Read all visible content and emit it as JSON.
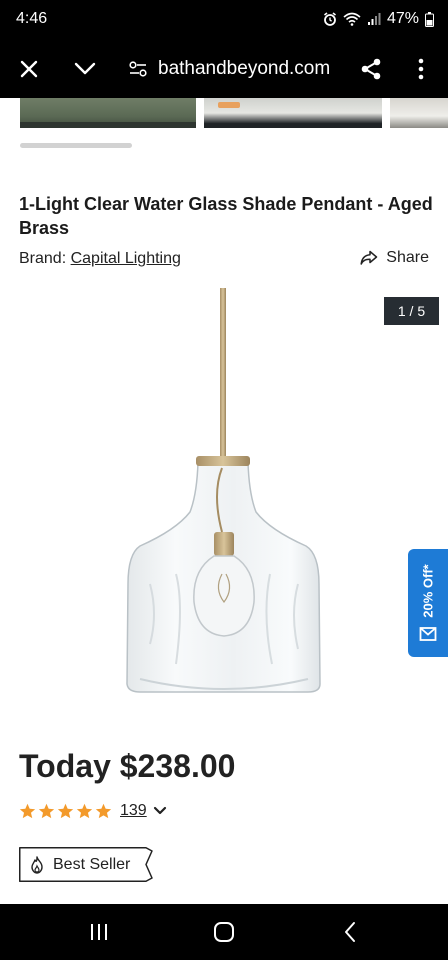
{
  "status_bar": {
    "time": "4:46",
    "battery": "47%",
    "icons": [
      "alarm-icon",
      "wifi-icon",
      "signal-icon",
      "battery-icon"
    ]
  },
  "browser": {
    "url": "bathandbeyond.com",
    "icons": [
      "close-icon",
      "chevron-down-icon",
      "site-settings-icon",
      "share-icon",
      "more-vert-icon"
    ]
  },
  "gallery": {
    "thumbnails": [
      "thumb-1",
      "thumb-2",
      "thumb-3"
    ]
  },
  "product": {
    "title": "1-Light Clear Water Glass Shade Pendant - Aged Brass",
    "brand_label": "Brand:",
    "brand_name": "Capital Lighting",
    "share_label": "Share",
    "image_counter": "1 / 5",
    "price": "Today $238.00",
    "rating_value": 5,
    "review_count": "139",
    "badge": "Best Seller"
  },
  "promo": {
    "label": "20% Off*",
    "color": "#1e7bd6"
  },
  "colors": {
    "star": "#f39a2b",
    "counter_bg": "#272d33",
    "text": "#222222"
  },
  "nav": {
    "icons": [
      "recents-icon",
      "home-icon",
      "back-icon"
    ]
  }
}
